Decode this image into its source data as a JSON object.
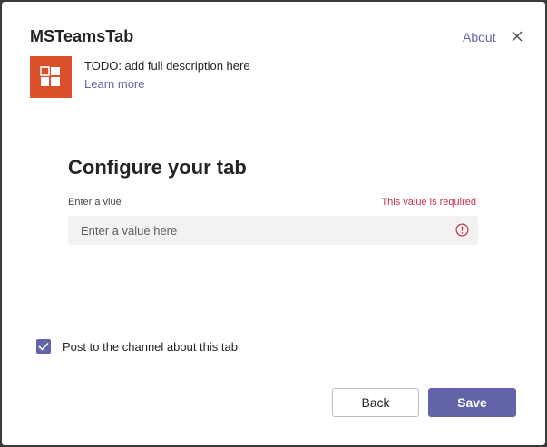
{
  "dialog": {
    "title": "MSTeamsTab",
    "about_label": "About",
    "close_icon": "close-icon",
    "app_icon": "app-tile-icon",
    "app_icon_color": "#d9502b",
    "description": "TODO: add full description here",
    "learn_more_label": "Learn more"
  },
  "config": {
    "heading": "Configure your tab",
    "field_label": "Enter a vlue",
    "field_error": "This value is required",
    "field_placeholder": "Enter a value here",
    "field_value": "",
    "error_icon": "error-circle-icon",
    "error_color": "#c4314b"
  },
  "footer": {
    "post_checkbox_label": "Post to the channel about this tab",
    "post_checkbox_checked": true,
    "back_label": "Back",
    "save_label": "Save",
    "accent_color": "#6264a7"
  }
}
